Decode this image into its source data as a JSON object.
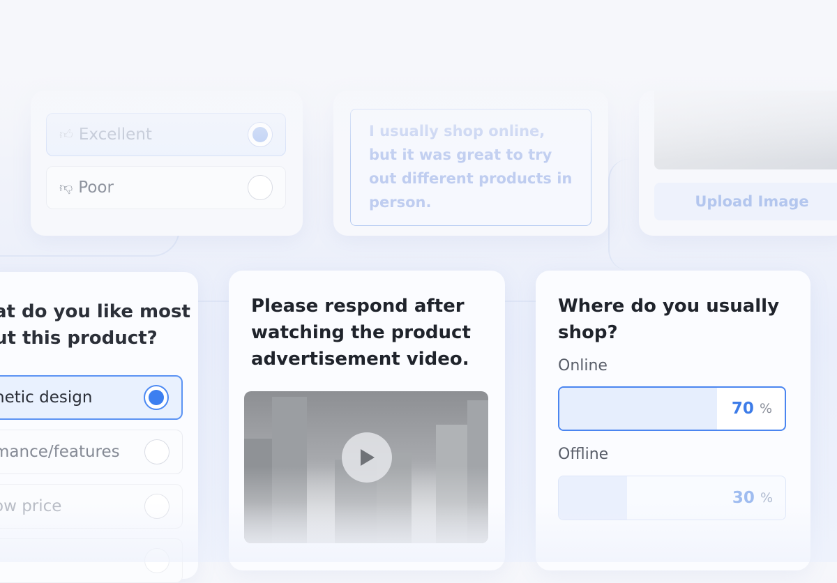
{
  "rating_card": {
    "options": [
      {
        "label": "Excellent",
        "icon": "thumbs-up-icon",
        "selected": true
      },
      {
        "label": "Poor",
        "icon": "thumbs-down-icon",
        "selected": false
      }
    ]
  },
  "feedback_card": {
    "response_text": "I usually shop online, but it was great to try out different products in person."
  },
  "upload_card": {
    "button_label": "Upload Image"
  },
  "likes_card": {
    "question": "at do you like most ut this product?",
    "options": [
      {
        "label": "hetic design",
        "selected": true
      },
      {
        "label": "mance/features",
        "selected": false
      },
      {
        "label": "ow price",
        "selected": false
      }
    ]
  },
  "video_card": {
    "question": "Please respond after watching the product advertisement video.",
    "play_icon": "play-icon"
  },
  "shop_card": {
    "question": "Where do you usually shop?",
    "options": [
      {
        "label": "Online",
        "value": 70,
        "unit": "%"
      },
      {
        "label": "Offline",
        "value": 30,
        "unit": "%"
      }
    ]
  },
  "colors": {
    "accent": "#3c7ff0",
    "accent_light": "#e6eefd",
    "text_dark": "#1f232b"
  }
}
